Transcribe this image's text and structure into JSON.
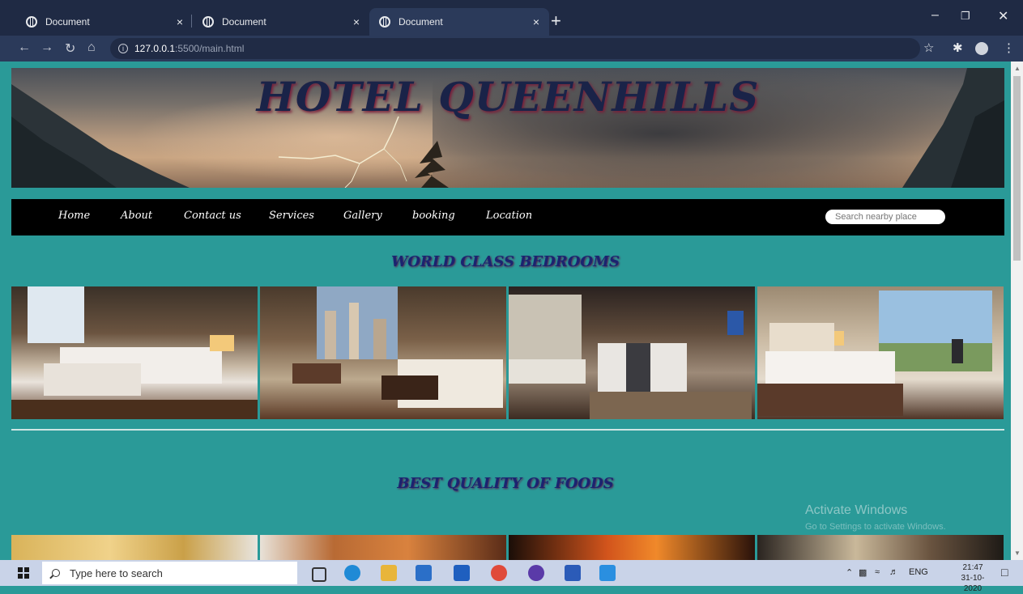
{
  "browser": {
    "tabs": [
      {
        "title": "Document",
        "active": false
      },
      {
        "title": "Document",
        "active": false
      },
      {
        "title": "Document",
        "active": true
      }
    ],
    "new_tab_symbol": "+",
    "close_symbol": "×",
    "url_host": "127.0.0.1",
    "url_rest": ":5500/main.html"
  },
  "site": {
    "title": "HOTEL QUEENHILLS",
    "nav": [
      "Home",
      "About",
      "Contact us",
      "Services",
      "Gallery",
      "booking",
      "Location"
    ],
    "search_placeholder": "Search nearby place",
    "sections": {
      "bedrooms": "WORLD CLASS BEDROOMS",
      "foods": "BEST QUALITY OF FOODS"
    }
  },
  "watermark": {
    "line1": "Activate Windows",
    "line2": "Go to Settings to activate Windows."
  },
  "taskbar": {
    "search_placeholder": "Type here to search",
    "language": "ENG",
    "time": "21:47",
    "date": "31-10-2020"
  },
  "colors": {
    "page_bg": "#2a9a98",
    "nav_bg": "#000000",
    "title_color": "#1a2348",
    "section_title": "#1b2370"
  }
}
